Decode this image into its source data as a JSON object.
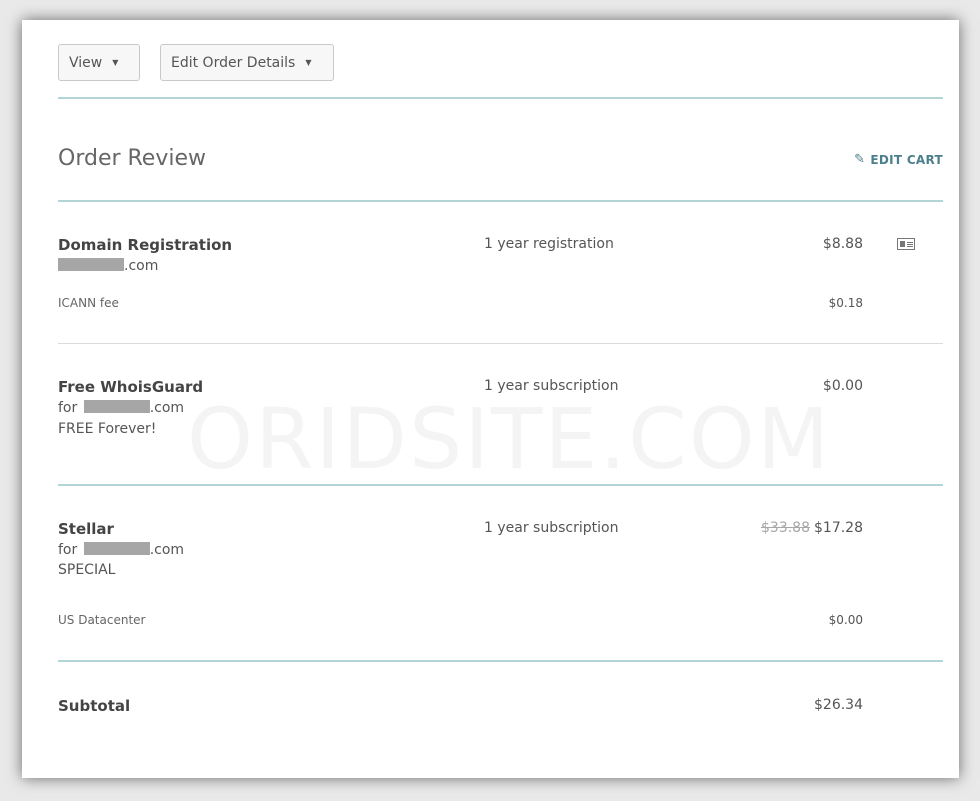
{
  "toolbar": {
    "view_label": "View",
    "edit_order_label": "Edit Order Details"
  },
  "header": {
    "title": "Order Review",
    "edit_cart_label": "EDIT CART"
  },
  "items": [
    {
      "name": "Domain Registration",
      "domain_suffix": ".com",
      "term": "1 year registration",
      "price": "$8.88",
      "extra_label": "ICANN fee",
      "extra_price": "$0.18"
    },
    {
      "name": "Free WhoisGuard",
      "for_prefix": "for",
      "domain_suffix": ".com",
      "note": "FREE Forever!",
      "term": "1 year subscription",
      "price": "$0.00"
    },
    {
      "name": "Stellar",
      "for_prefix": "for",
      "domain_suffix": ".com",
      "note": "SPECIAL",
      "term": "1 year subscription",
      "old_price": "$33.88",
      "price": "$17.28",
      "extra_label": "US Datacenter",
      "extra_price": "$0.00"
    }
  ],
  "subtotal": {
    "label": "Subtotal",
    "value": "$26.34"
  },
  "watermark": "ORIDSITE.COM",
  "colors": {
    "teal_divider": "#b4d5d5",
    "accent": "#4c7f8c"
  }
}
